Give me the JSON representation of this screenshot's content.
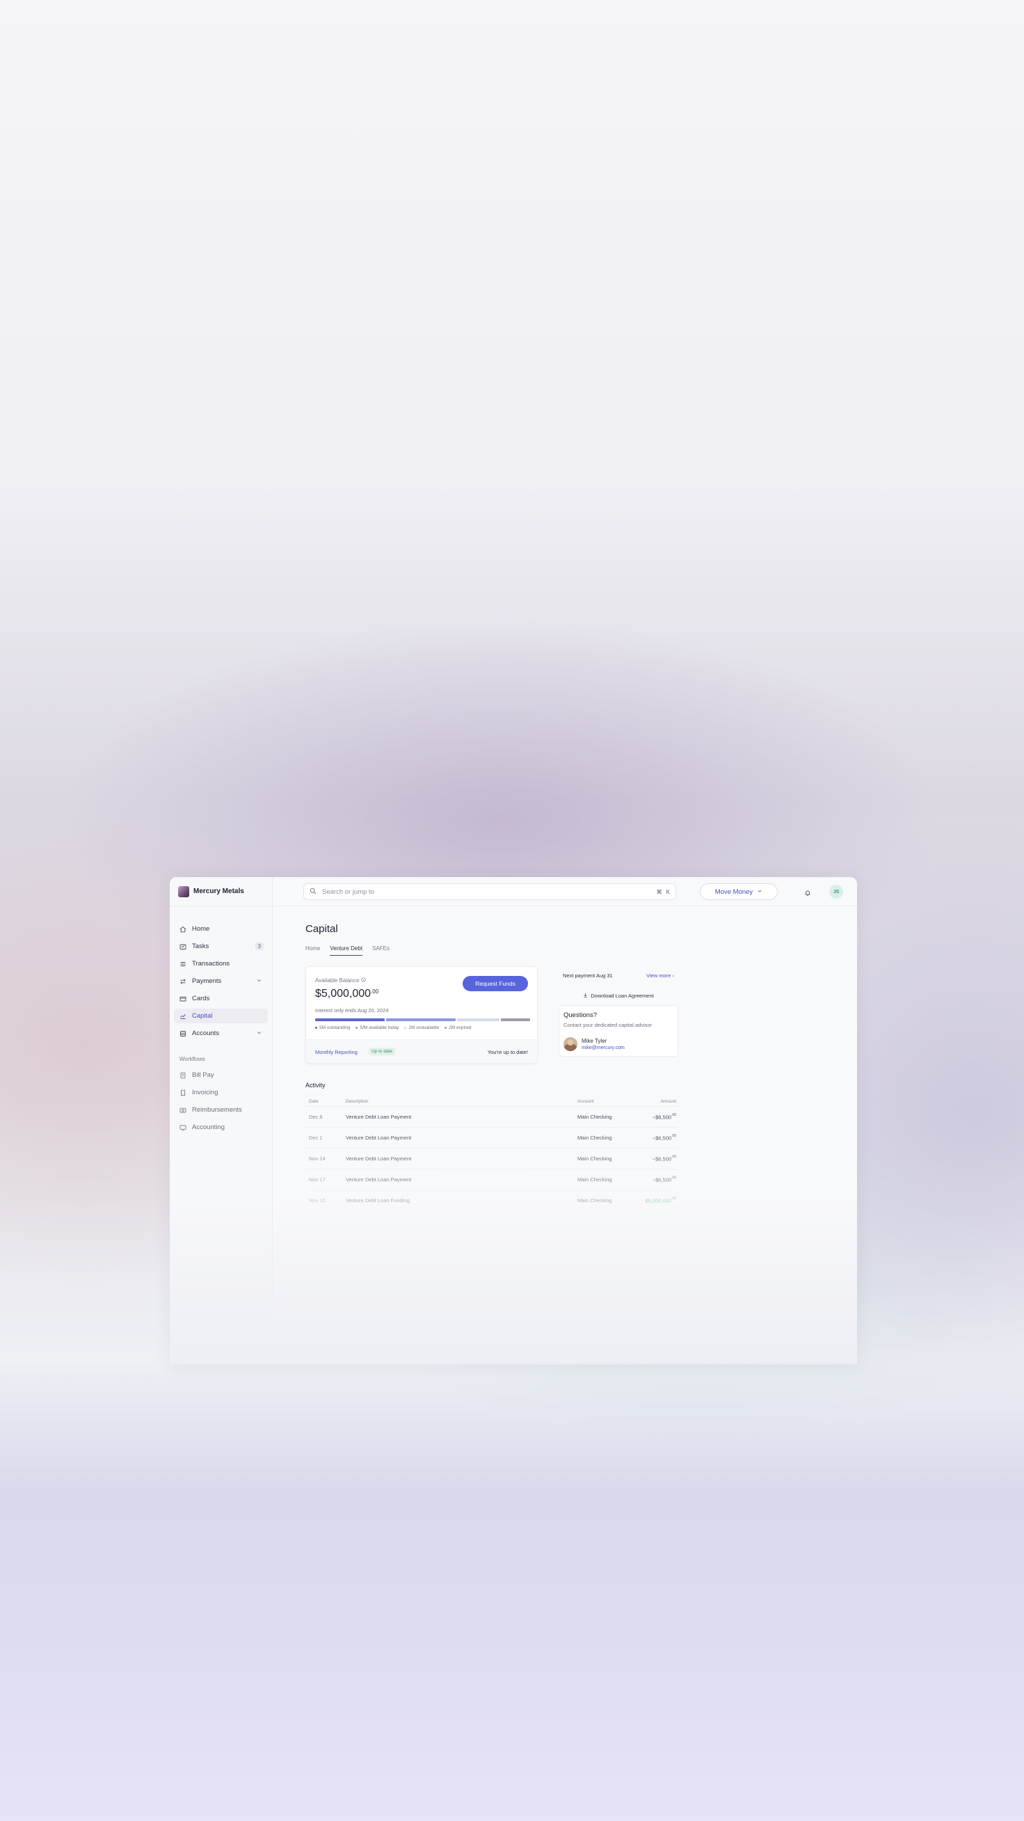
{
  "org": {
    "name": "Mercury Metals"
  },
  "sidebar": {
    "items": [
      {
        "label": "Home",
        "icon": "home-icon"
      },
      {
        "label": "Tasks",
        "icon": "tasks-icon",
        "badge": "3"
      },
      {
        "label": "Transactions",
        "icon": "transactions-icon"
      },
      {
        "label": "Payments",
        "icon": "payments-icon"
      },
      {
        "label": "Cards",
        "icon": "card-icon"
      },
      {
        "label": "Capital",
        "icon": "capital-icon"
      },
      {
        "label": "Accounts",
        "icon": "accounts-icon"
      }
    ],
    "workflows_label": "Workflows",
    "workflows": [
      {
        "label": "Bill Pay",
        "icon": "bill-pay-icon"
      },
      {
        "label": "Invoicing",
        "icon": "invoicing-icon"
      },
      {
        "label": "Reimbursements",
        "icon": "reimbursements-icon"
      },
      {
        "label": "Accounting",
        "icon": "accounting-icon"
      }
    ]
  },
  "topbar": {
    "search_placeholder": "Search or jump to",
    "shortcut_mod": "⌘",
    "shortcut_key": "K",
    "move_money_label": "Move Money",
    "avatar_initials": "JS"
  },
  "page": {
    "title": "Capital",
    "tabs": [
      {
        "label": "Home"
      },
      {
        "label": "Venture Debt"
      },
      {
        "label": "SAFEs"
      }
    ]
  },
  "balance": {
    "label": "Available Balance",
    "value_main": "$5,000,000",
    "value_cents": ".00",
    "request_label": "Request Funds",
    "interest_note": "Interest only ends Aug 20, 2024",
    "progress": [
      {
        "label": "5M outstanding",
        "share": 0.33,
        "color": "#5864dc"
      },
      {
        "label": "5/M available today",
        "share": 0.33,
        "color": "#8e96e6"
      },
      {
        "label": "2M unavailable",
        "share": 0.2,
        "color": "#d7d9f0"
      },
      {
        "label": "2M expired",
        "share": 0.14,
        "color": "#9b9ca6"
      }
    ],
    "reporting_label": "Monthly Reporting",
    "reporting_status": "Up to date",
    "up_to_date_note": "You're up to date!"
  },
  "side": {
    "next_payment": "Next payment Aug 31",
    "view_more": "View more",
    "download_label": "Download Loan Agreement",
    "questions_title": "Questions?",
    "questions_sub": "Contact your dedicated capital advisor",
    "advisor_name": "Mike Tyler",
    "advisor_email": "mike@mercury.com"
  },
  "activity": {
    "title": "Activity",
    "columns": {
      "date": "Date",
      "description": "Description",
      "account": "Account",
      "amount": "Amount"
    },
    "rows": [
      {
        "date": "Dec 8",
        "description": "Venture Debt Loan Payment",
        "account": "Main Checking",
        "amount": "−$6,500",
        "cents": ".00",
        "positive": false,
        "opacity": 1.0
      },
      {
        "date": "Dec 1",
        "description": "Venture Debt Loan Payment",
        "account": "Main Checking",
        "amount": "−$6,500",
        "cents": ".00",
        "positive": false,
        "opacity": 0.9
      },
      {
        "date": "Nov 24",
        "description": "Venture Debt Loan Payment",
        "account": "Main Checking",
        "amount": "−$6,500",
        "cents": ".00",
        "positive": false,
        "opacity": 0.78
      },
      {
        "date": "Nov 17",
        "description": "Venture Debt Loan Payment",
        "account": "Main Checking",
        "amount": "−$6,500",
        "cents": ".00",
        "positive": false,
        "opacity": 0.62
      },
      {
        "date": "Nov 10",
        "description": "Venture Debt Loan Funding",
        "account": "Main Checking",
        "amount": "$5,000,000",
        "cents": ".00",
        "positive": true,
        "opacity": 0.42
      }
    ]
  }
}
